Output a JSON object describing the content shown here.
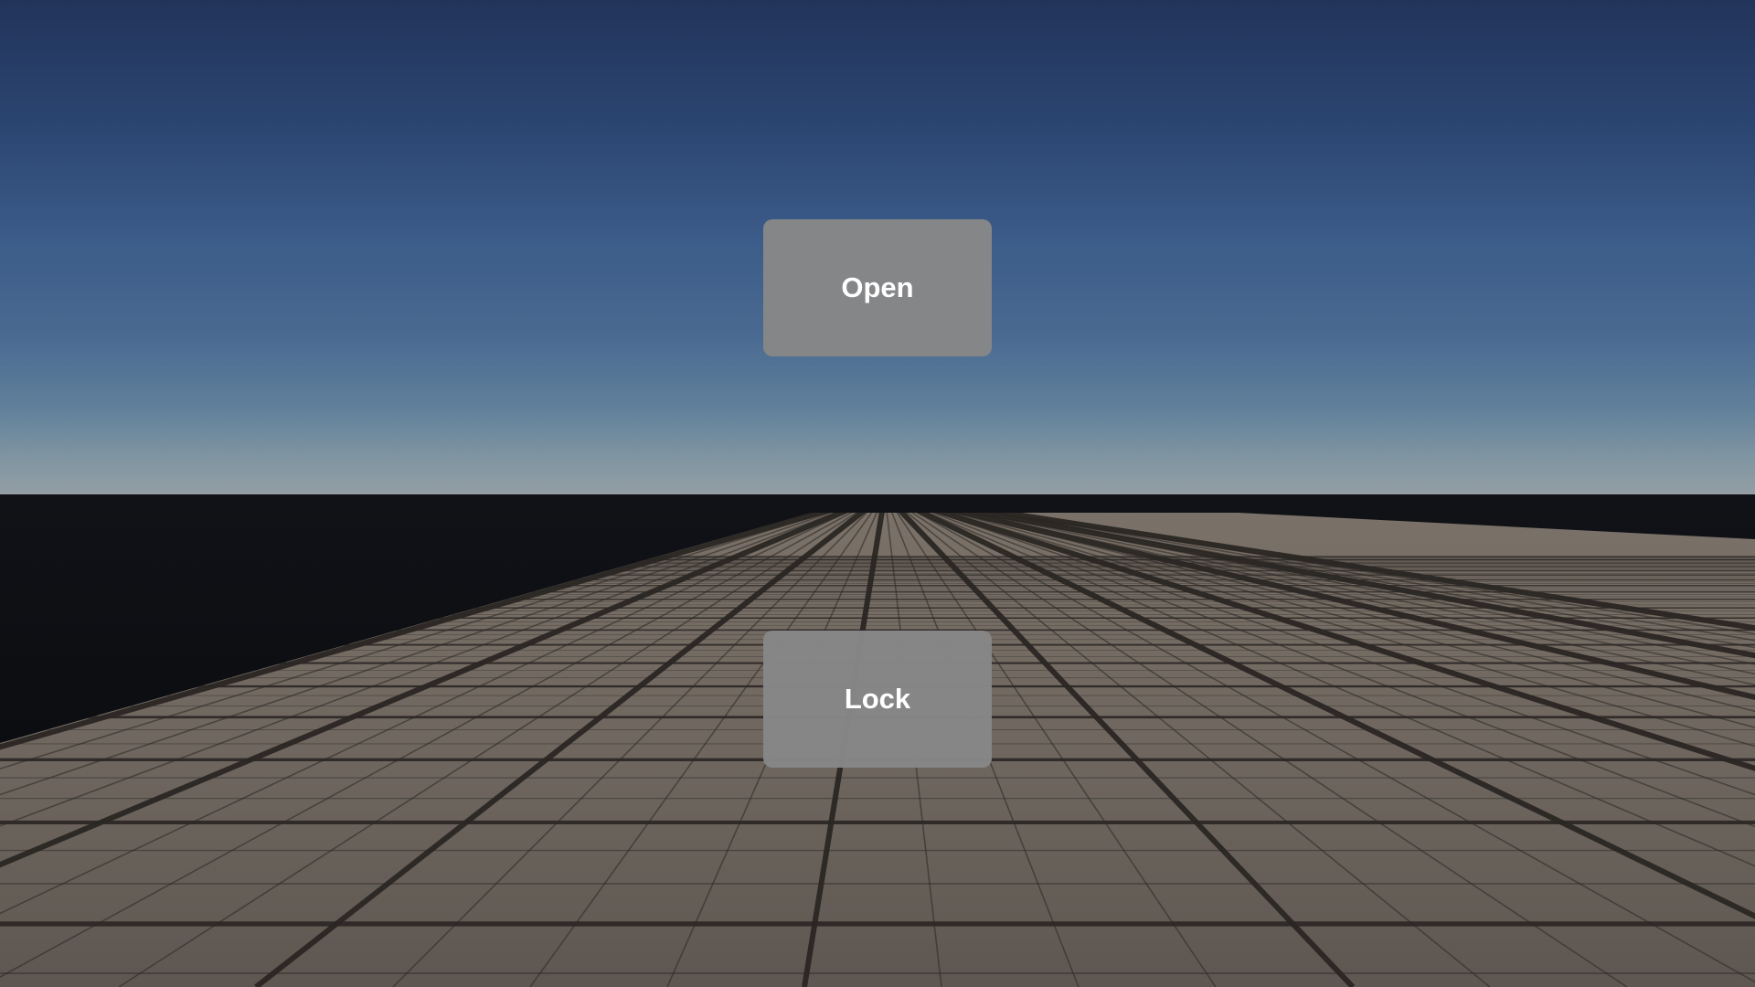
{
  "buttons": {
    "open_label": "Open",
    "lock_label": "Lock"
  },
  "colors": {
    "sky_top": "#22345a",
    "sky_horizon": "#949ea4",
    "void": "#0a0b0e",
    "floor": "#6e665f",
    "grid_line": "#2e2a27",
    "button_bg": "#878787",
    "button_text": "#ffffff"
  }
}
